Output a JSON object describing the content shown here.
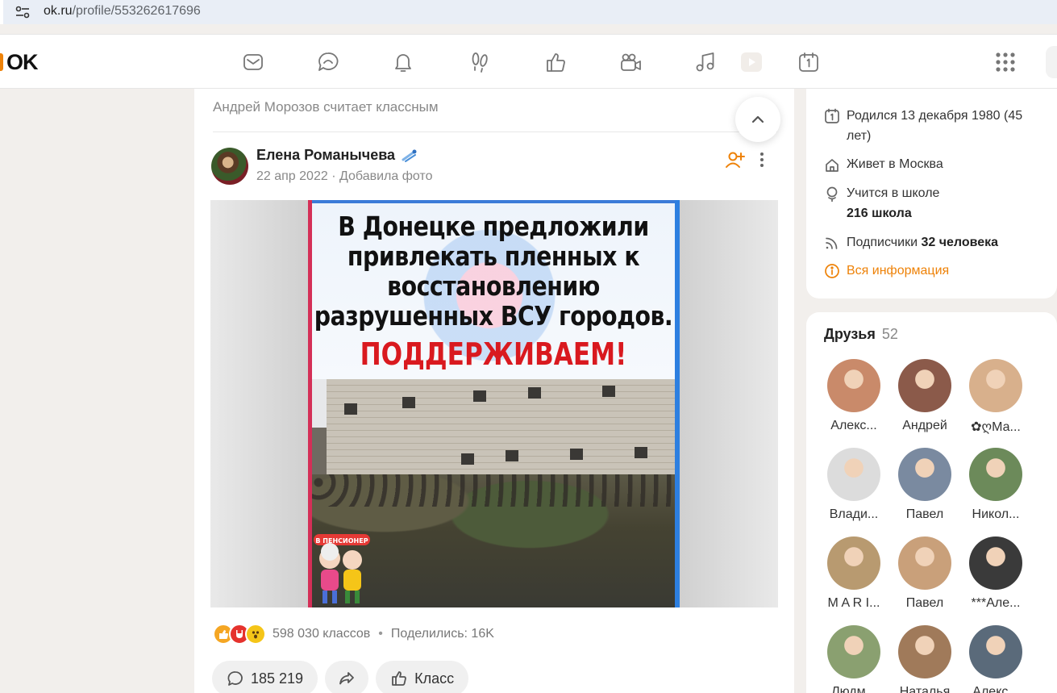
{
  "browser": {
    "url_host": "ok.ru",
    "url_path": "/profile/553262617696"
  },
  "header": {
    "logo_text": "OK",
    "brand_color": "#ee8208",
    "icons": [
      "mail-icon",
      "chat-icon",
      "bell-icon",
      "footprints-icon",
      "like-icon",
      "video-camera-icon",
      "music-icon",
      "video-play-icon",
      "calendar-icon"
    ]
  },
  "feed": {
    "liked_by": "Андрей Морозов считает классным",
    "post": {
      "author": "Елена Романычева",
      "date": "22 апр 2022",
      "action": "Добавила фото",
      "meta_separator": "·",
      "photo_title": "В Донецке предложили привлекать пленных к восстановлению разрушенных ВСУ городов.",
      "photo_claim": "ПОДДЕРЖИВАЕМ!",
      "photo_sticker": "В ПЕНСИОНЕР",
      "reactions_text": "598 030 классов",
      "shared_text": "Поделились: 16K",
      "reaction_separator": "•",
      "comments_count": "185 219",
      "like_label": "Класс"
    }
  },
  "profile_info": {
    "born": "Родился 13 декабря 1980 (45 лет)",
    "lives_prefix": "Живет в ",
    "lives_city": "Москва",
    "school_prefix": "Учится в школе",
    "school_name": "216 школа",
    "subscribers_prefix": "Подписчики ",
    "subscribers_count": "32 человека",
    "all_info": "Вся информация"
  },
  "friends": {
    "title": "Друзья",
    "count": "52",
    "items": [
      {
        "name": "Алекс...",
        "color": "#c98a6a"
      },
      {
        "name": "Андрей",
        "color": "#8b5a4a"
      },
      {
        "name": "✿ღМа...",
        "color": "#d8b08c"
      },
      {
        "name": "Влади...",
        "color": "#dcdcdc"
      },
      {
        "name": "Павел",
        "color": "#7a8aa0"
      },
      {
        "name": "Никол...",
        "color": "#6c8a5a"
      },
      {
        "name": "M A R I...",
        "color": "#b89a70"
      },
      {
        "name": "Павел",
        "color": "#c9a07a"
      },
      {
        "name": "***Але...",
        "color": "#3a3a3a"
      },
      {
        "name": "Людм...",
        "color": "#8aa070"
      },
      {
        "name": "Наталья",
        "color": "#a07a5a"
      },
      {
        "name": "Алекс...",
        "color": "#5a6a7a"
      }
    ]
  }
}
